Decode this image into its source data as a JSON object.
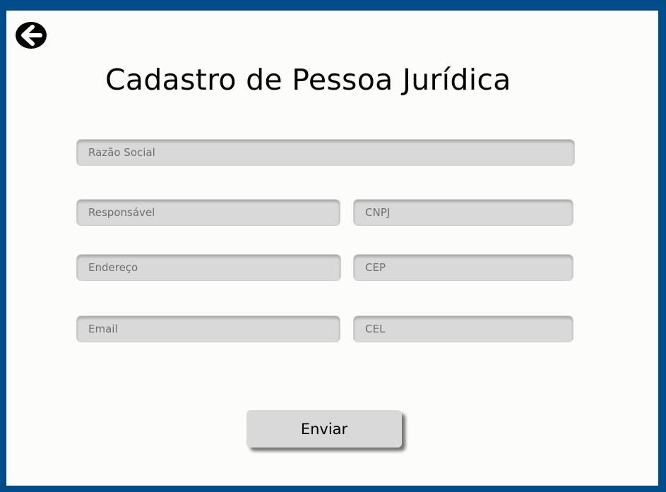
{
  "page": {
    "title": "Cadastro de Pessoa Jurídica",
    "back_icon": "arrow-left-circle-icon"
  },
  "form": {
    "razao_social": {
      "placeholder": "Razão Social",
      "value": ""
    },
    "responsavel": {
      "placeholder": "Responsável",
      "value": ""
    },
    "cnpj": {
      "placeholder": "CNPJ",
      "value": ""
    },
    "endereco": {
      "placeholder": "Endereço",
      "value": ""
    },
    "cep": {
      "placeholder": "CEP",
      "value": ""
    },
    "email": {
      "placeholder": "Email",
      "value": ""
    },
    "cel": {
      "placeholder": "CEL",
      "value": ""
    },
    "submit_label": "Enviar"
  },
  "colors": {
    "border_blue": "#004C8A",
    "background": "#FCFDFA",
    "field": "#D9D9D9",
    "button": "#D9D9D9"
  }
}
